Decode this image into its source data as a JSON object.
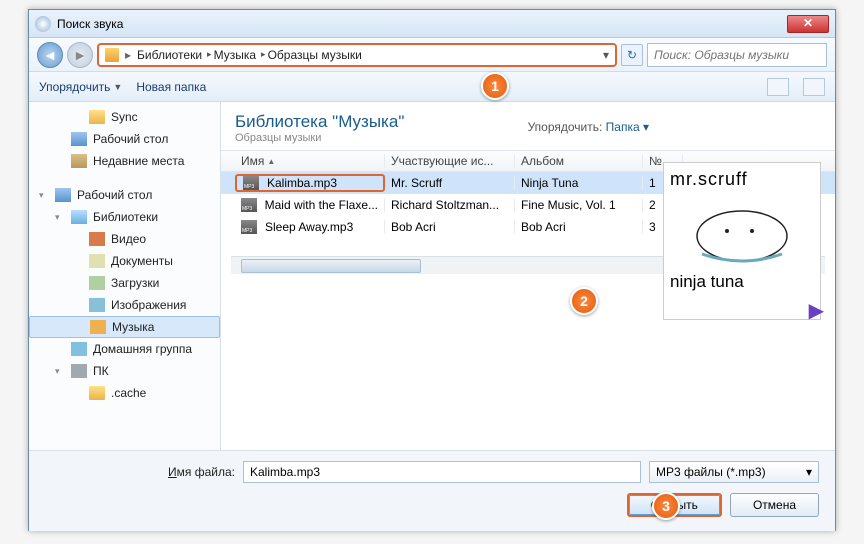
{
  "window": {
    "title": "Поиск звука"
  },
  "nav": {
    "segments": [
      "Библиотеки",
      "Музыка",
      "Образцы музыки"
    ],
    "search_placeholder": "Поиск: Образцы музыки"
  },
  "toolbar": {
    "organize": "Упорядочить",
    "newfolder": "Новая папка"
  },
  "sidebar": {
    "items": [
      {
        "label": "Sync",
        "icon": "fold",
        "indent": 2
      },
      {
        "label": "Рабочий стол",
        "icon": "desk",
        "indent": 1
      },
      {
        "label": "Недавние места",
        "icon": "recent",
        "indent": 1
      },
      {
        "label": "Рабочий стол",
        "icon": "desk",
        "indent": 0,
        "expand": true
      },
      {
        "label": "Библиотеки",
        "icon": "lib",
        "indent": 1,
        "expand": true
      },
      {
        "label": "Видео",
        "icon": "vid",
        "indent": 2
      },
      {
        "label": "Документы",
        "icon": "doc",
        "indent": 2
      },
      {
        "label": "Загрузки",
        "icon": "dl",
        "indent": 2
      },
      {
        "label": "Изображения",
        "icon": "img",
        "indent": 2
      },
      {
        "label": "Музыка",
        "icon": "mus",
        "indent": 2,
        "selected": true
      },
      {
        "label": "Домашняя группа",
        "icon": "hg",
        "indent": 1
      },
      {
        "label": "ПК",
        "icon": "pc",
        "indent": 1,
        "expand": true
      },
      {
        "label": ".cache",
        "icon": "fold",
        "indent": 2
      }
    ]
  },
  "main": {
    "lib_title": "Библиотека \"Музыка\"",
    "lib_sub": "Образцы музыки",
    "sort_label": "Упорядочить:",
    "sort_value": "Папка",
    "columns": {
      "name": "Имя",
      "artist": "Участвующие ис...",
      "album": "Альбом",
      "num": "№"
    },
    "rows": [
      {
        "name": "Kalimba.mp3",
        "artist": "Mr. Scruff",
        "album": "Ninja Tuna",
        "num": "1",
        "selected": true
      },
      {
        "name": "Maid with the Flaxe...",
        "artist": "Richard Stoltzman...",
        "album": "Fine Music, Vol. 1",
        "num": "2"
      },
      {
        "name": "Sleep Away.mp3",
        "artist": "Bob Acri",
        "album": "Bob Acri",
        "num": "3"
      }
    ],
    "preview": {
      "line1": "mr.scruff",
      "line2": "ninja tuna"
    }
  },
  "footer": {
    "filename_label": "Имя файла:",
    "filename_value": "Kalimba.mp3",
    "filetype": "MP3 файлы (*.mp3)",
    "open": "Открыть",
    "cancel": "Отмена"
  },
  "callouts": {
    "c1": "1",
    "c2": "2",
    "c3": "3"
  }
}
